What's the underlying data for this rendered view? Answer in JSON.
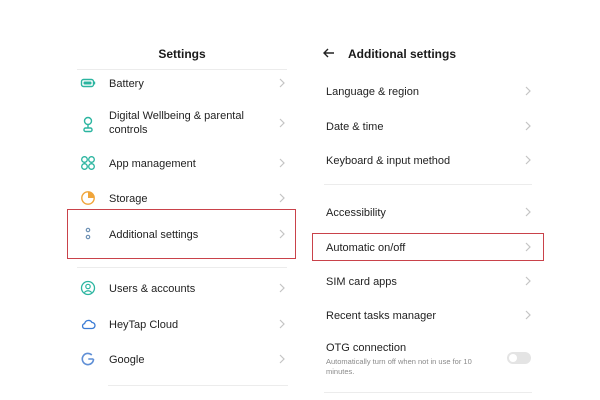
{
  "left": {
    "title": "Settings",
    "items": [
      {
        "label": "Battery",
        "icon": "battery-icon"
      },
      {
        "label": "Digital Wellbeing & parental controls",
        "line1": "Digital Wellbeing & parental",
        "line2": "controls",
        "icon": "wellbeing-icon"
      },
      {
        "label": "App management",
        "icon": "apps-grid-icon"
      },
      {
        "label": "Storage",
        "icon": "storage-pie-icon"
      },
      {
        "label": "Additional settings",
        "icon": "more-dots-icon",
        "highlighted": true
      },
      {
        "label": "Users & accounts",
        "icon": "user-icon"
      },
      {
        "label": "HeyTap Cloud",
        "icon": "cloud-icon"
      },
      {
        "label": "Google",
        "icon": "google-icon"
      }
    ]
  },
  "right": {
    "title": "Additional settings",
    "items": [
      {
        "label": "Language & region"
      },
      {
        "label": "Date & time"
      },
      {
        "label": "Keyboard & input method"
      },
      {
        "label": "Accessibility"
      },
      {
        "label": "Automatic on/off",
        "highlighted": true
      },
      {
        "label": "SIM card apps"
      },
      {
        "label": "Recent tasks manager"
      },
      {
        "label": "OTG connection",
        "subtext_line1": "Automatically turn off when not in use for 10",
        "subtext_line2": "minutes.",
        "toggle": "off"
      }
    ]
  },
  "colors": {
    "icon_accent": "#2bb5a0",
    "highlight_border": "#c9424a",
    "divider": "#ececec"
  }
}
